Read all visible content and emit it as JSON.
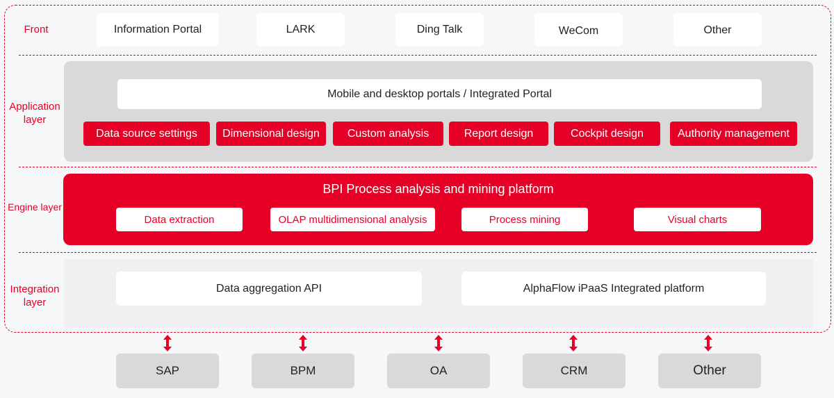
{
  "colors": {
    "accent": "#e60026",
    "background": "#f6f7f9",
    "panel_gray": "#d9d9d9",
    "integration_bg": "#f0f0f0",
    "white": "#ffffff",
    "text_dark": "#222222"
  },
  "front": {
    "label": "Front",
    "items": [
      "Information Portal",
      "LARK",
      "Ding Talk",
      "WeCom",
      "Other"
    ]
  },
  "application": {
    "label_line1": "Application",
    "label_line2": "layer",
    "portal": "Mobile and desktop portals / Integrated Portal",
    "modules": [
      "Data source settings",
      "Dimensional design",
      "Custom analysis",
      "Report design",
      "Cockpit design",
      "Authority management"
    ]
  },
  "engine": {
    "label": "Engine layer",
    "title": "BPI  Process analysis and mining platform",
    "items": [
      "Data extraction",
      "OLAP multidimensional analysis",
      "Process mining",
      "Visual charts"
    ]
  },
  "integration": {
    "label_line1": "Integration",
    "label_line2": "layer",
    "items": [
      "Data aggregation API",
      "AlphaFlow iPaaS Integrated platform"
    ]
  },
  "systems": {
    "connector_icon": "double-arrow-vertical",
    "items": [
      "SAP",
      "BPM",
      "OA",
      "CRM",
      "Other"
    ]
  }
}
